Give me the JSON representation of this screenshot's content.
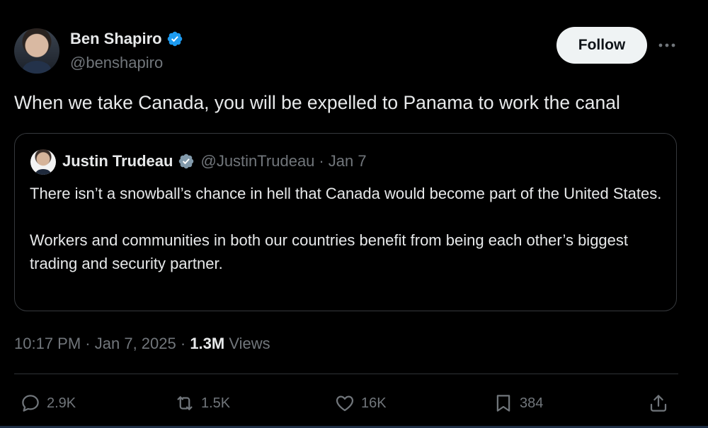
{
  "author": {
    "name": "Ben Shapiro",
    "handle": "@benshapiro"
  },
  "follow_label": "Follow",
  "tweet_text": "When we take Canada, you will be expelled to Panama to work the canal",
  "quote": {
    "name": "Justin Trudeau",
    "handle": "@JustinTrudeau",
    "separator": "·",
    "date": "Jan 7",
    "paragraphs": [
      "There isn’t a snowball’s chance in hell that Canada would become part of the United States.",
      "Workers and communities in both our countries benefit from being each other’s biggest trading and security partner."
    ]
  },
  "meta": {
    "time": "10:17 PM",
    "sep1": "·",
    "date": "Jan 7, 2025",
    "sep2": "·",
    "views_count": "1.3M",
    "views_label": "Views"
  },
  "actions": {
    "replies": "2.9K",
    "reposts": "1.5K",
    "likes": "16K",
    "bookmarks": "384"
  },
  "colors": {
    "background": "#000000",
    "text": "#e7e9ea",
    "muted": "#71767b",
    "verified": "#1d9bf0",
    "border": "#36393d"
  },
  "icons": {
    "verified": "verified-badge-icon",
    "more": "more-dots-icon",
    "reply": "reply-icon",
    "repost": "repost-icon",
    "like": "heart-icon",
    "bookmark": "bookmark-icon",
    "share": "share-icon"
  }
}
